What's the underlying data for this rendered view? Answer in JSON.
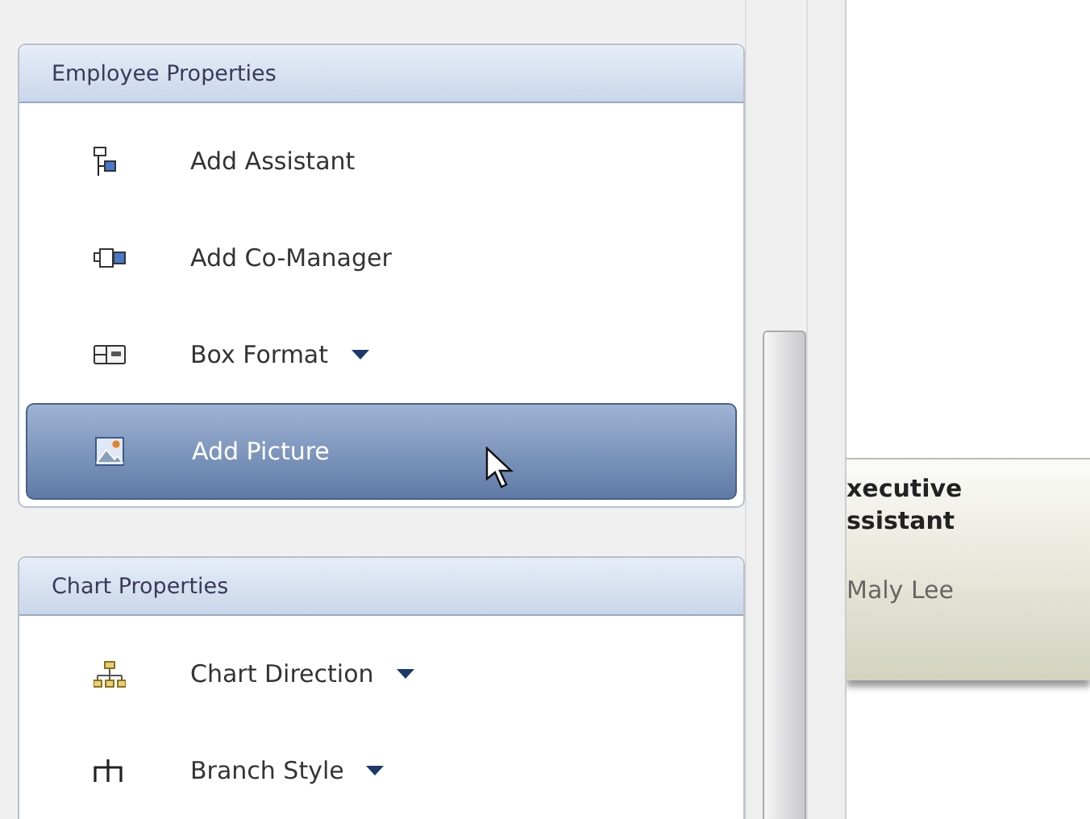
{
  "sections": [
    {
      "title": "Employee Properties",
      "items": [
        {
          "label": "Add Assistant",
          "dropdown": false,
          "selected": false
        },
        {
          "label": "Add Co-Manager",
          "dropdown": false,
          "selected": false
        },
        {
          "label": "Box Format",
          "dropdown": true,
          "selected": false
        },
        {
          "label": "Add Picture",
          "dropdown": false,
          "selected": true
        }
      ]
    },
    {
      "title": "Chart Properties",
      "items": [
        {
          "label": "Chart Direction",
          "dropdown": true,
          "selected": false
        },
        {
          "label": "Branch Style",
          "dropdown": true,
          "selected": false
        }
      ]
    }
  ],
  "org_box": {
    "title_lines": [
      "xecutive",
      "ssistant"
    ],
    "name": "Maly Lee"
  }
}
